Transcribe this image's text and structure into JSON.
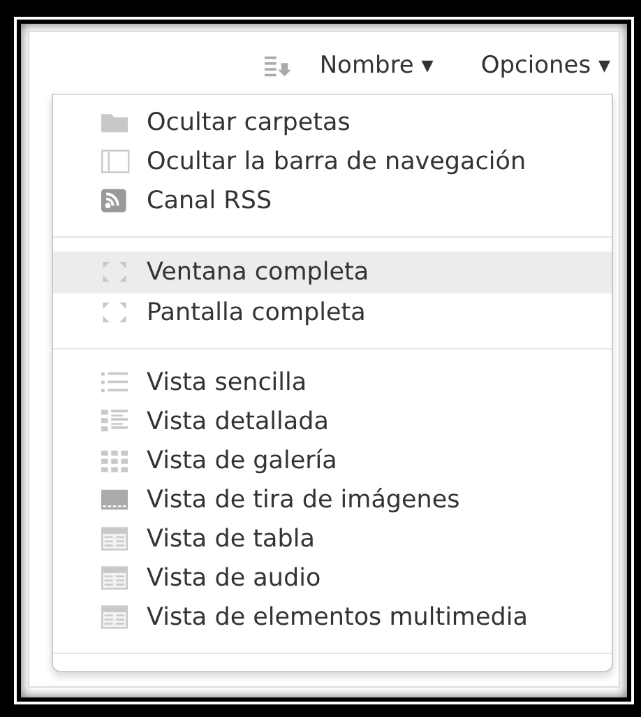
{
  "toolbar": {
    "sort_label": "Nombre",
    "sort_caret": "▾",
    "options_label": "Opciones",
    "options_caret": "▾"
  },
  "menu": {
    "sections": [
      {
        "items": [
          {
            "label": "Ocultar carpetas",
            "kind": "folder",
            "highlighted": false
          },
          {
            "label": "Ocultar la barra de navegación",
            "kind": "sidebar",
            "highlighted": false
          },
          {
            "label": "Canal RSS",
            "kind": "rss",
            "highlighted": false
          }
        ]
      },
      {
        "items": [
          {
            "label": "Ventana completa",
            "kind": "expand",
            "highlighted": true
          },
          {
            "label": "Pantalla completa",
            "kind": "expand",
            "highlighted": false
          }
        ]
      },
      {
        "items": [
          {
            "label": "Vista sencilla",
            "kind": "list",
            "highlighted": false
          },
          {
            "label": "Vista detallada",
            "kind": "details",
            "highlighted": false
          },
          {
            "label": "Vista de galería",
            "kind": "grid",
            "highlighted": false
          },
          {
            "label": "Vista de tira de imágenes",
            "kind": "filmstrip",
            "highlighted": false
          },
          {
            "label": "Vista de tabla",
            "kind": "table",
            "highlighted": false
          },
          {
            "label": "Vista de audio",
            "kind": "table",
            "highlighted": false
          },
          {
            "label": "Vista de elementos multimedia",
            "kind": "table",
            "highlighted": false
          }
        ]
      }
    ]
  }
}
